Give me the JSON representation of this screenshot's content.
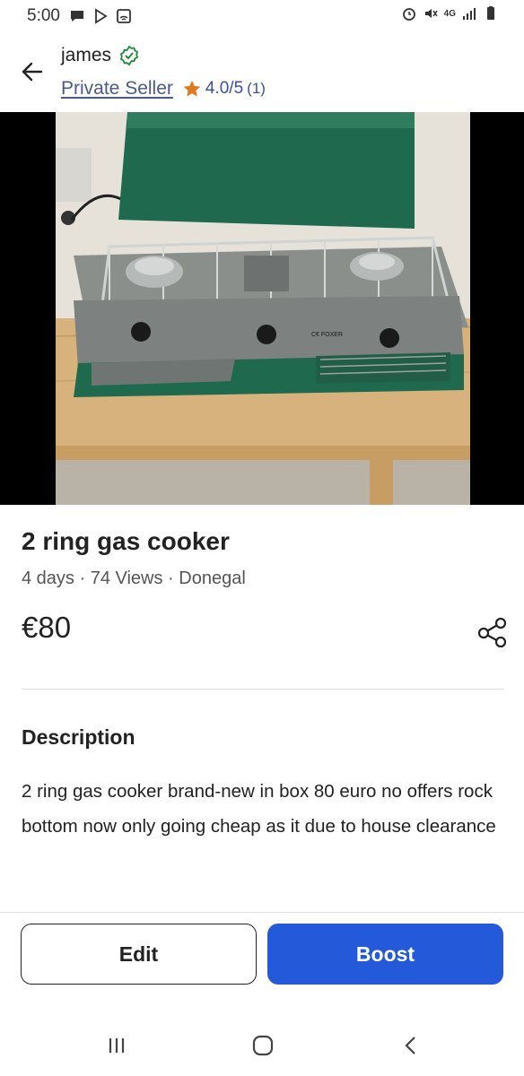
{
  "status_bar": {
    "time": "5:00",
    "left_icons": [
      "chat-bubble-icon",
      "play-store-icon",
      "sim-card-icon"
    ],
    "right_icons": [
      "alarm-icon",
      "mute-icon",
      "4g-icon",
      "signal-icon",
      "battery-icon"
    ],
    "network": "4G"
  },
  "header": {
    "back_icon": "arrow-left-icon",
    "seller_name": "james",
    "verified_icon": "verified-check-icon",
    "seller_type": "Private Seller",
    "rating": "4.0/5",
    "rating_count": "(1)",
    "rating_color": "#e07a1f"
  },
  "listing": {
    "title": "2 ring gas cooker",
    "meta": "4 days · 74 Views · Donegal",
    "price": "€80",
    "share_icon": "share-icon"
  },
  "description": {
    "heading": "Description",
    "text": "2 ring gas cooker brand-new in box 80 euro no offers rock bottom now only going cheap as it due to house clearance"
  },
  "actions": {
    "edit_label": "Edit",
    "boost_label": "Boost",
    "boost_color": "#2459d9"
  },
  "nav": {
    "recents_icon": "recents-icon",
    "home_icon": "home-icon",
    "back_icon": "nav-back-icon"
  }
}
